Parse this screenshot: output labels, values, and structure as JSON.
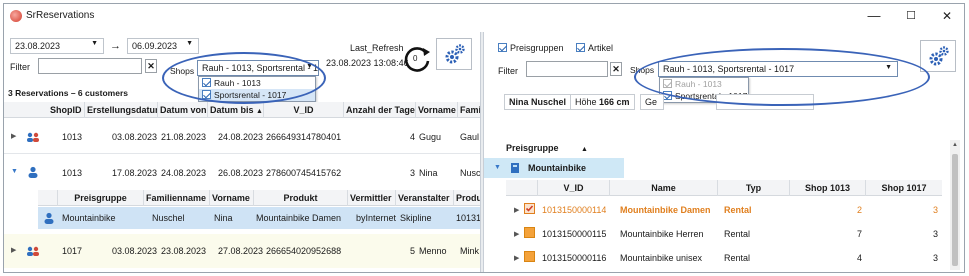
{
  "window": {
    "title": "SrReservations",
    "minimize": "—",
    "maximize": "☐",
    "close": "✕"
  },
  "left": {
    "date_from": "23.08.2023",
    "arrow": "→",
    "date_to": "06.09.2023",
    "filter_label": "Filter",
    "filter_value": "",
    "clear": "✕",
    "shops_label": "Shops",
    "shops_value": "Rauh - 1013, Sportsrental - 1017",
    "shop_options": [
      {
        "label": "Rauh - 1013",
        "checked": true
      },
      {
        "label": "Sportsrental - 1017",
        "checked": true
      }
    ],
    "last_refresh_label": "Last_Refresh",
    "last_refresh_value": "23.08.2023 13:08:46",
    "refresh_count": "0",
    "summary": "3 Reservations – 6 customers",
    "columns": [
      "ShopID",
      "Erstellungsdatum",
      "Datum von",
      "Datum bis",
      "V_ID",
      "Anzahl der Tage",
      "Vorname",
      "Fami"
    ],
    "rows": [
      {
        "shop": "1013",
        "created": "03.08.2023",
        "from": "21.08.2023",
        "to": "24.08.2023",
        "vid": "266649314780401",
        "days": "4",
        "first": "Gugu",
        "last": "Gaul"
      },
      {
        "shop": "1013",
        "created": "17.08.2023",
        "from": "24.08.2023",
        "to": "26.08.2023",
        "vid": "278600745415762",
        "days": "3",
        "first": "Nina",
        "last": "Nusc"
      },
      {
        "shop": "1017",
        "created": "03.08.2023",
        "from": "23.08.2023",
        "to": "27.08.2023",
        "vid": "266654020952688",
        "days": "5",
        "first": "Menno",
        "last": "Mink"
      }
    ],
    "sub_columns": [
      "Preisgruppe",
      "Familienname",
      "Vorname",
      "Produkt",
      "Vermittler",
      "Veranstalter",
      "Produ"
    ],
    "sub_row": {
      "group": "Mountainbike",
      "last": "Nuschel",
      "first": "Nina",
      "product": "Mountainbike Damen",
      "agent": "byInternet",
      "organizer": "Skipline",
      "prod": "10131"
    }
  },
  "right": {
    "opt_preisgruppen": "Preisgruppen",
    "opt_artikel": "Artikel",
    "filter_label": "Filter",
    "filter_value": "",
    "clear": "✕",
    "shops_label": "Shops",
    "shops_value": "Rauh - 1013, Sportsrental - 1017",
    "shop_options": [
      {
        "label": "Rauh - 1013",
        "checked": true,
        "disabled": true
      },
      {
        "label": "Sportsrental - 1017",
        "checked": true,
        "disabled": false
      }
    ],
    "customer": "Nina Nuschel",
    "height_label": "Höhe",
    "height_value": "166 cm",
    "ge_prefix": "Ge",
    "group_col": "Preisgruppe",
    "group_name": "Mountainbike",
    "columns": [
      "V_ID",
      "Name",
      "Typ",
      "Shop 1013",
      "Shop 1017"
    ],
    "rows": [
      {
        "vid": "1013150000114",
        "name": "Mountainbike Damen",
        "typ": "Rental",
        "s1013": "2",
        "s1017": "3",
        "highlight": true
      },
      {
        "vid": "1013150000115",
        "name": "Mountainbike Herren",
        "typ": "Rental",
        "s1013": "7",
        "s1017": "3",
        "highlight": false
      },
      {
        "vid": "1013150000116",
        "name": "Mountainbike unisex",
        "typ": "Rental",
        "s1013": "4",
        "s1017": "3",
        "highlight": false
      }
    ]
  },
  "colors": {
    "accent": "#3a63b8",
    "highlight": "#e07f1e",
    "selected_row": "#cfe3f5",
    "group_band": "#cfe8f6"
  }
}
